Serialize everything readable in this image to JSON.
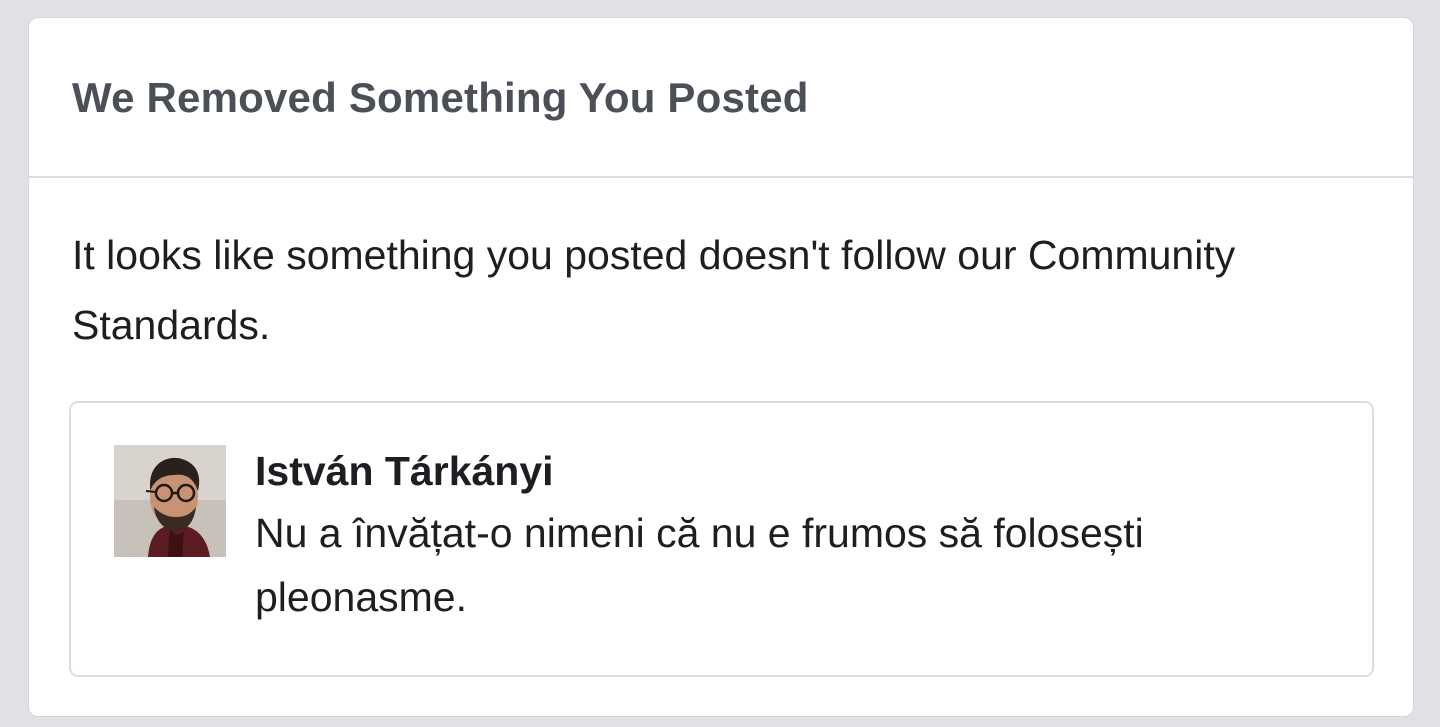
{
  "notice": {
    "title": "We Removed Something You Posted",
    "message": "It looks like something you posted doesn't follow our Community Standards."
  },
  "post": {
    "author": "István Tárkányi",
    "text": "Nu a învățat-o nimeni că nu e frumos să folosești pleonasme.",
    "avatar_icon": "user-photo-avatar"
  },
  "colors": {
    "background": "#dfe1e5",
    "card": "#ffffff",
    "title": "#4b4f56",
    "text": "#1c1e21",
    "border": "#dadde1"
  }
}
